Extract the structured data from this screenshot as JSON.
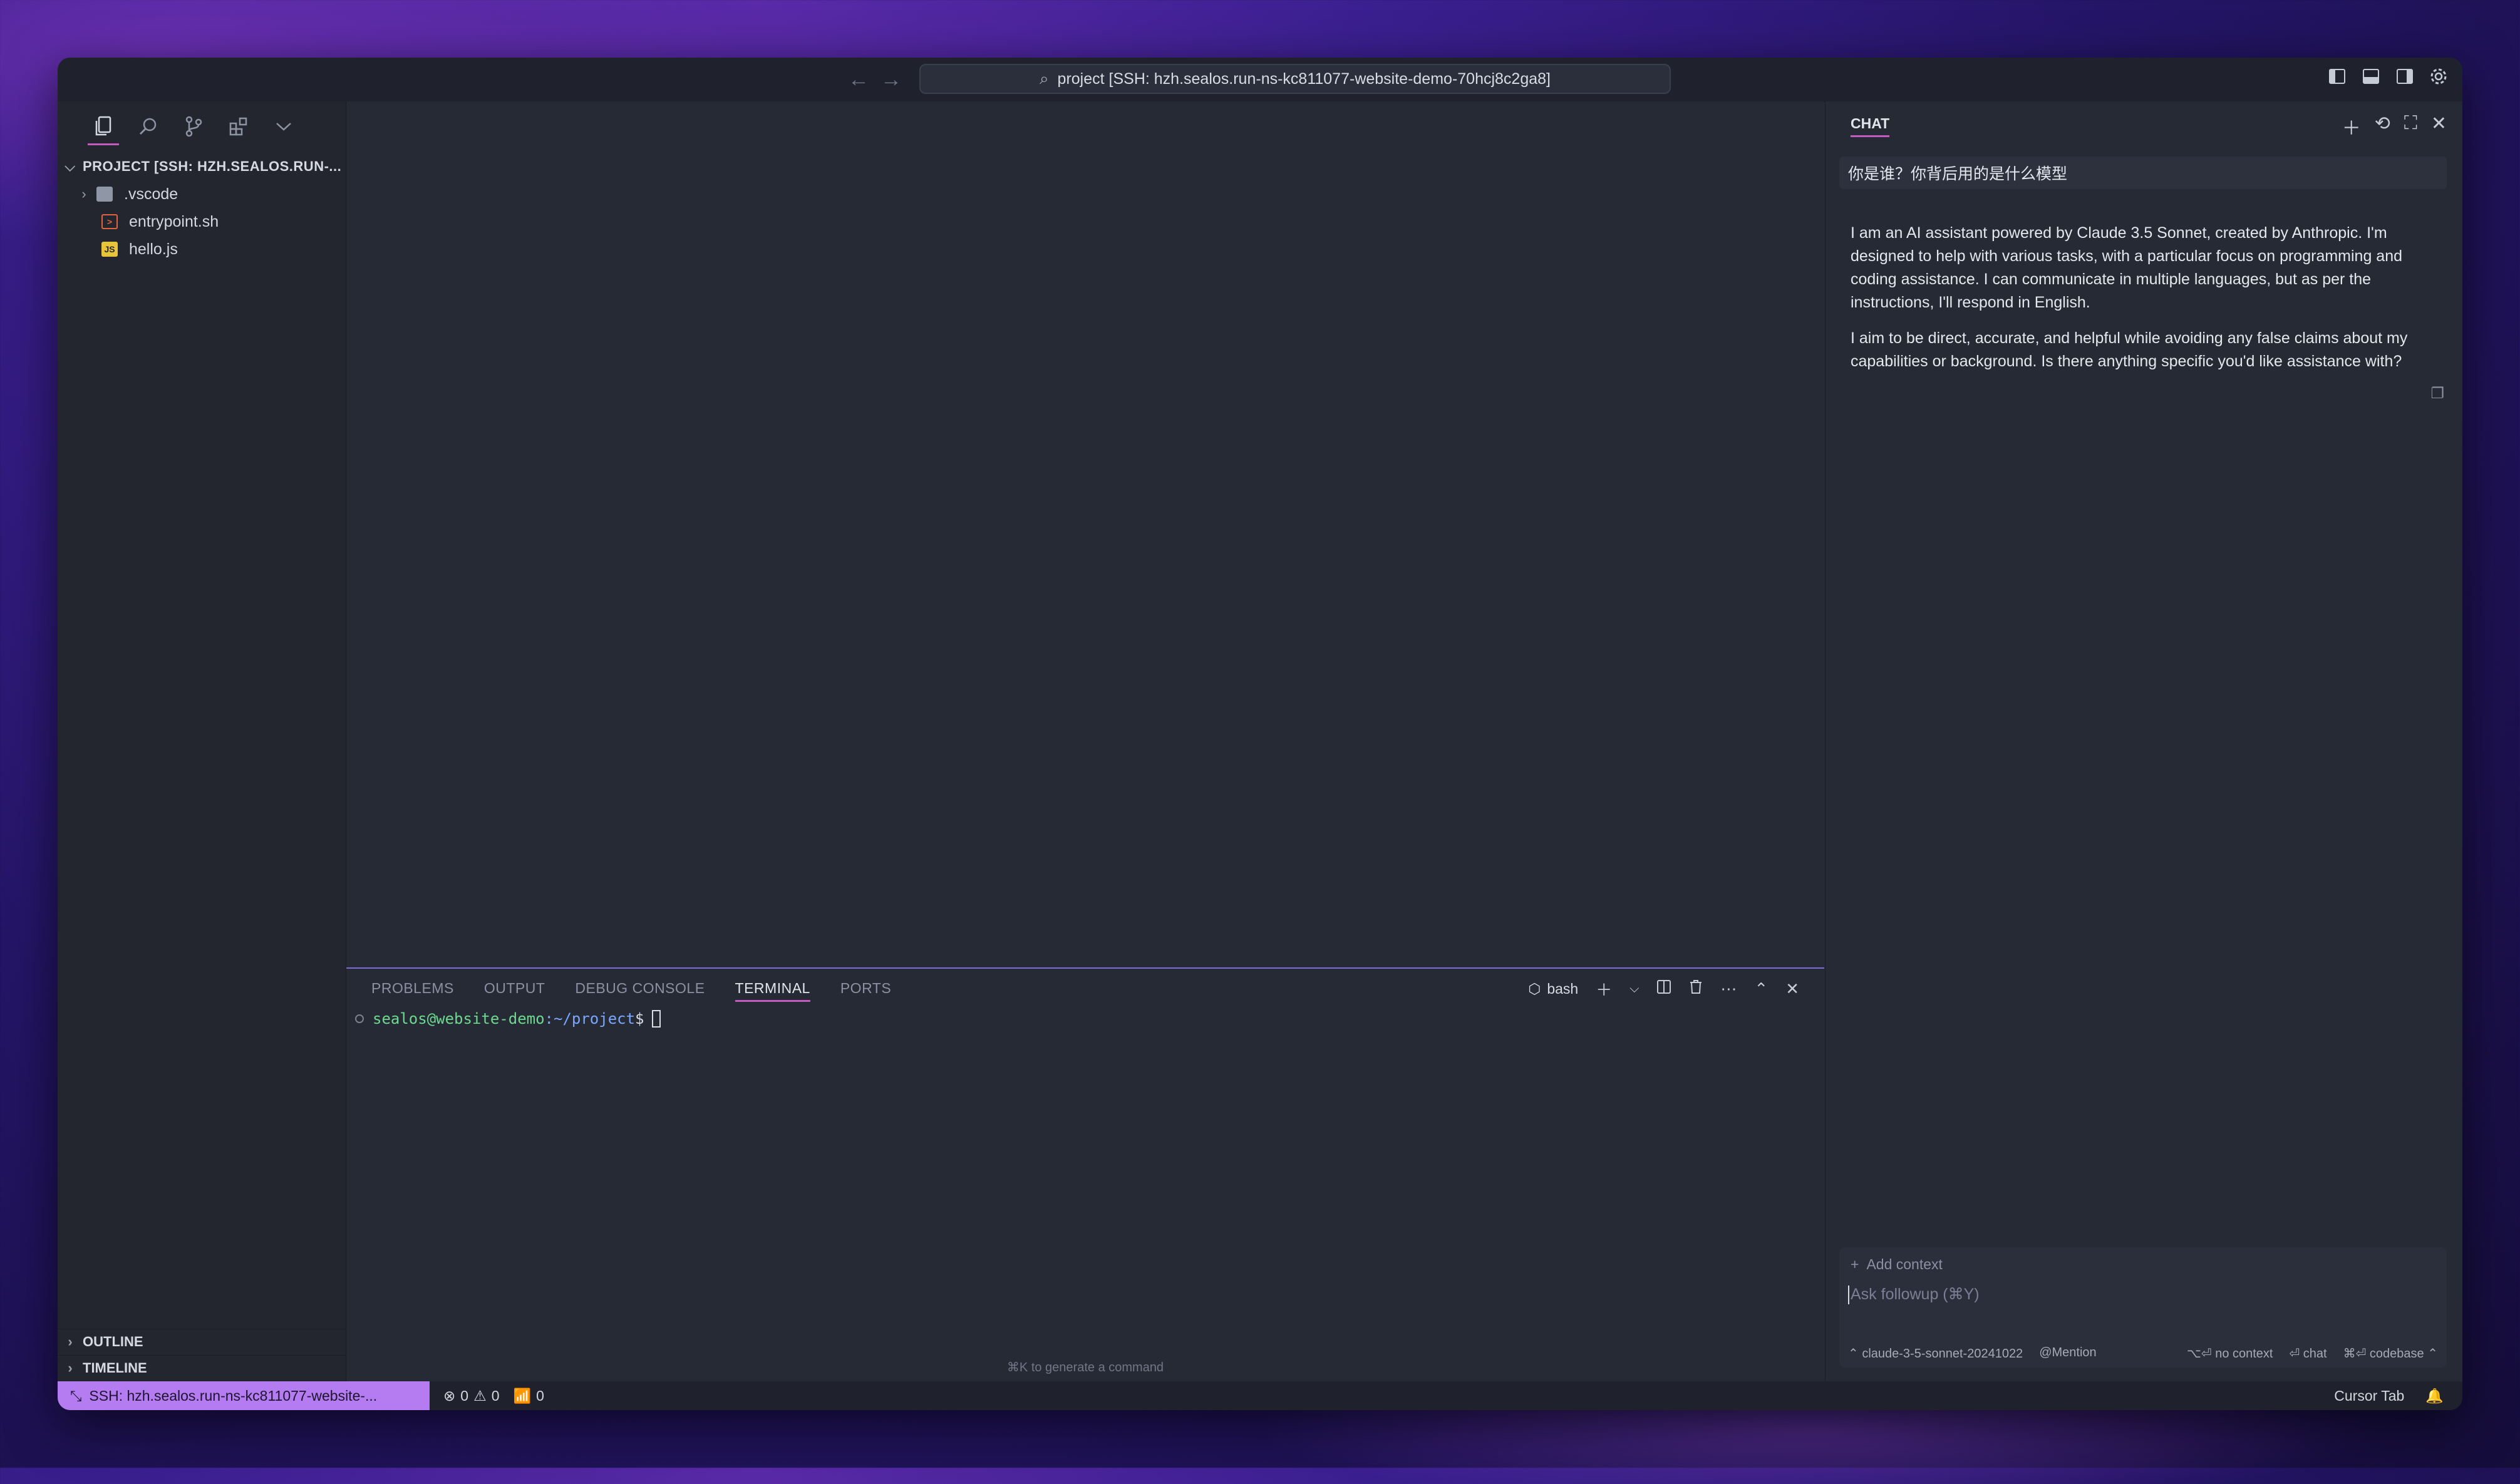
{
  "titlebar": {
    "back": "←",
    "forward": "→",
    "command_center": "project [SSH: hzh.sealos.run-ns-kc811077-website-demo-70hcj8c2ga8]"
  },
  "explorer": {
    "project_title": "PROJECT [SSH: HZH.SEALOS.RUN-...",
    "items": [
      {
        "label": ".vscode",
        "type": "folder"
      },
      {
        "label": "entrypoint.sh",
        "type": "shell"
      },
      {
        "label": "hello.js",
        "type": "js"
      }
    ],
    "outline_label": "OUTLINE",
    "timeline_label": "TIMELINE"
  },
  "panel": {
    "tabs": [
      "PROBLEMS",
      "OUTPUT",
      "DEBUG CONSOLE",
      "TERMINAL",
      "PORTS"
    ],
    "active_tab": "TERMINAL",
    "shell_name": "bash",
    "prompt_user": "sealos@website-demo",
    "prompt_path": ":~/project",
    "prompt_symbol": "$",
    "hint": "⌘K to generate a command"
  },
  "chat": {
    "title": "CHAT",
    "user_message": "你是谁？你背后用的是什么模型",
    "ai_paragraphs": [
      "I am an AI assistant powered by Claude 3.5 Sonnet, created by Anthropic. I'm designed to help with various tasks, with a particular focus on programming and coding assistance. I can communicate in multiple languages, but as per the instructions, I'll respond in English.",
      "I aim to be direct, accurate, and helpful while avoiding any false claims about my capabilities or background. Is there anything specific you'd like assistance with?"
    ],
    "add_context": "Add context",
    "input_placeholder": "Ask followup (⌘Y)",
    "model": "claude-3-5-sonnet-20241022",
    "mention": "Mention",
    "no_context": "⌥⏎ no context",
    "chat_action": "⏎ chat",
    "codebase_action": "⌘⏎ codebase"
  },
  "statusbar": {
    "remote": "SSH: hzh.sealos.run-ns-kc811077-website-...",
    "errors": "0",
    "warnings": "0",
    "ports": "0",
    "cursor_tab": "Cursor Tab"
  },
  "colors": {
    "accent": "#c65bbf",
    "remote_bg": "#b57bf0",
    "panel_border": "#7c6bd8"
  }
}
